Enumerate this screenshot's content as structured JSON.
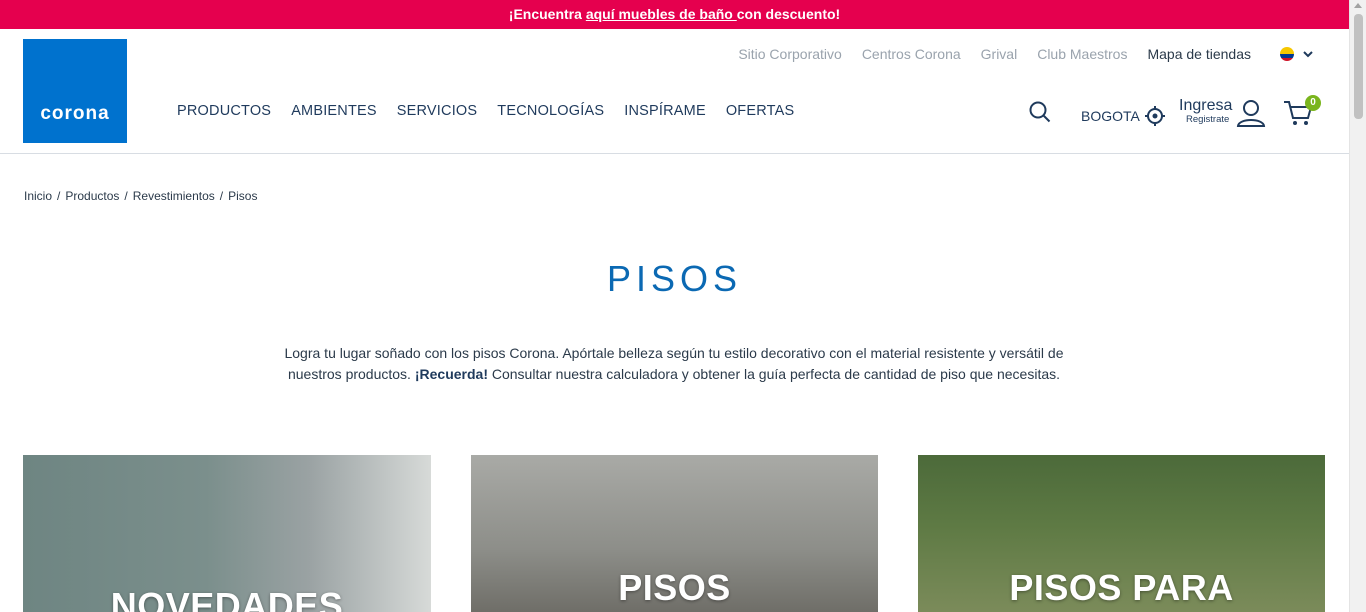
{
  "promo": {
    "before": "¡Encuentra ",
    "link": "aquí muebles de baño ",
    "after": "con descuento!"
  },
  "logo": {
    "text": "corona"
  },
  "top_links": [
    "Sitio Corporativo",
    "Centros Corona",
    "Grival",
    "Club Maestros",
    "Mapa de tiendas"
  ],
  "nav": [
    "PRODUCTOS",
    "AMBIENTES",
    "SERVICIOS",
    "TECNOLOGÍAS",
    "INSPÍRAME",
    "OFERTAS"
  ],
  "city": "BOGOTA",
  "login": {
    "label": "Ingresa",
    "sub": "Registrate"
  },
  "cart": {
    "count": "0"
  },
  "breadcrumb": [
    "Inicio",
    "Productos",
    "Revestimientos",
    "Pisos"
  ],
  "page_title": "PISOS",
  "description": {
    "part1": "Logra tu lugar soñado con los pisos Corona. Apórtale belleza según tu estilo decorativo con el material resistente y versátil de nuestros productos. ",
    "bold": "¡Recuerda!",
    "part2": " Consultar nuestra calculadora y obtener la guía perfecta de cantidad de piso que necesitas."
  },
  "cards": [
    {
      "label": "NOVEDADES"
    },
    {
      "label": "PISOS"
    },
    {
      "label": "PISOS PARA"
    }
  ],
  "colors": {
    "promo_bg": "#e5004e",
    "logo_bg": "#0072ce",
    "title": "#0b69b3",
    "cart_badge": "#7ab51d"
  },
  "icons": [
    "search-icon",
    "location-icon",
    "user-icon",
    "cart-icon",
    "chevron-down-icon",
    "colombia-flag-icon"
  ]
}
